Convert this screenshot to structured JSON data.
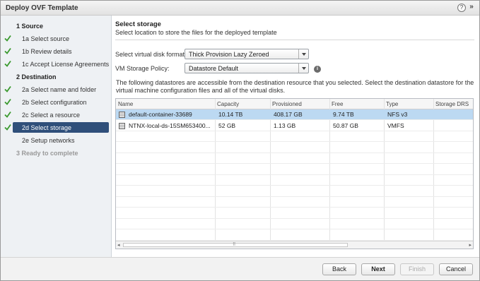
{
  "window": {
    "title": "Deploy OVF Template",
    "help_glyph": "?",
    "more_glyph": "»"
  },
  "steps": [
    {
      "num": "1",
      "label": "Source",
      "kind": "section",
      "done": false
    },
    {
      "num": "1a",
      "label": "Select source",
      "kind": "sub",
      "done": true
    },
    {
      "num": "1b",
      "label": "Review details",
      "kind": "sub",
      "done": true
    },
    {
      "num": "1c",
      "label": "Accept License Agreements",
      "kind": "sub",
      "done": true
    },
    {
      "num": "2",
      "label": "Destination",
      "kind": "section",
      "done": false
    },
    {
      "num": "2a",
      "label": "Select name and folder",
      "kind": "sub",
      "done": true
    },
    {
      "num": "2b",
      "label": "Select configuration",
      "kind": "sub",
      "done": true
    },
    {
      "num": "2c",
      "label": "Select a resource",
      "kind": "sub",
      "done": true
    },
    {
      "num": "2d",
      "label": "Select storage",
      "kind": "sub",
      "done": true,
      "active": true
    },
    {
      "num": "2e",
      "label": "Setup networks",
      "kind": "sub",
      "done": false
    },
    {
      "num": "3",
      "label": "Ready to complete",
      "kind": "section",
      "done": false,
      "disabled": true
    }
  ],
  "main": {
    "heading": "Select storage",
    "subheading": "Select location to store the files for the deployed template",
    "disk_format": {
      "label": "Select virtual disk format:",
      "value": "Thick Provision Lazy Zeroed"
    },
    "storage_policy": {
      "label": "VM Storage Policy:",
      "value": "Datastore Default"
    },
    "description": "The following datastores are accessible from the destination resource that you selected. Select the destination datastore for the virtual machine configuration files and all of the virtual disks."
  },
  "table": {
    "columns": [
      "Name",
      "Capacity",
      "Provisioned",
      "Free",
      "Type",
      "Storage DRS"
    ],
    "rows": [
      {
        "name": "default-container-33689",
        "capacity": "10.14 TB",
        "provisioned": "408.17 GB",
        "free": "9.74 TB",
        "type": "NFS v3",
        "drs": "",
        "selected": true
      },
      {
        "name": "NTNX-local-ds-15SM653400...",
        "capacity": "52 GB",
        "provisioned": "1.13 GB",
        "free": "50.87 GB",
        "type": "VMFS",
        "drs": "",
        "selected": false
      }
    ],
    "scroll_grip": "⠿",
    "scroll_left": "◂",
    "scroll_right": "▸"
  },
  "footer": {
    "back": "Back",
    "next": "Next",
    "finish": "Finish",
    "cancel": "Cancel"
  },
  "colors": {
    "check": "#3a9a2e",
    "active_step": "#2f4f7a",
    "selected_row": "#bcd9f2"
  }
}
